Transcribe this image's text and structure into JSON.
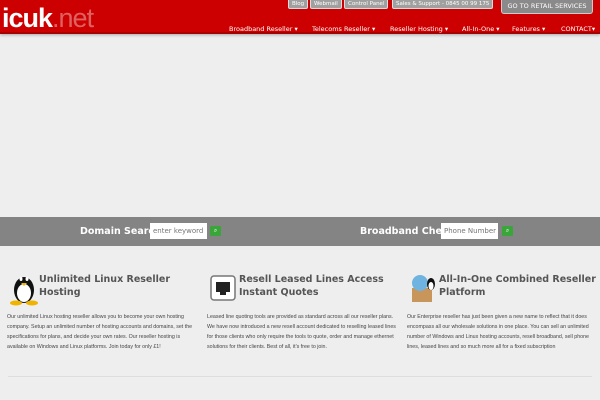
{
  "header": {
    "logo": "icuk",
    "logo_suffix": ".net",
    "top_links": [
      "Blog",
      "Webmail",
      "Control Panel",
      "Sales & Support - 0845 00 99 175"
    ],
    "retail_button": "GO TO RETAIL SERVICES",
    "nav": [
      "Broadband Reseller ▾",
      "Telecoms Reseller ▾",
      "Reseller Hosting ▾",
      "All-In-One ▾",
      "Features ▾",
      "CONTACT▾"
    ]
  },
  "search": {
    "domain_label": "Domain Search",
    "domain_placeholder": "enter keyword",
    "broadband_label": "Broadband Check",
    "broadband_placeholder": "Phone Number",
    "search_glyph": "🔍"
  },
  "features": [
    {
      "icon": "linux-penguin-icon",
      "title": "Unlimited Linux Reseller Hosting",
      "text": "Our unlimited Linux hosting reseller allows you to become your own hosting company. Setup an unlimited number of hosting accounts and domains, set the specifications for plans, and decide your own rates. Our reseller hosting is available on Windows and Linux platforms. Join today for only £1!"
    },
    {
      "icon": "ethernet-port-icon",
      "title": "Resell Leased Lines Access Instant Quotes",
      "text": "Leased line quoting tools are provided as standard across all our reseller plans. We have now introduced a new resell account dedicated to reselling leased lines for those clients who only require the tools to quote, order and manage ethernet solutions for their clients. Best of all, it's free to join."
    },
    {
      "icon": "combined-platform-box-icon",
      "title": "All-In-One Combined Reseller Platform",
      "text": "Our Enterprise reseller has just been given a new name to reflect that it does encompass all our wholesale solutions in one place. You can sell an unlimited number of Windows and Linux hosting accounts, resell broadband, sell phone lines, leased lines and so much more all for a fixed subscription"
    }
  ]
}
